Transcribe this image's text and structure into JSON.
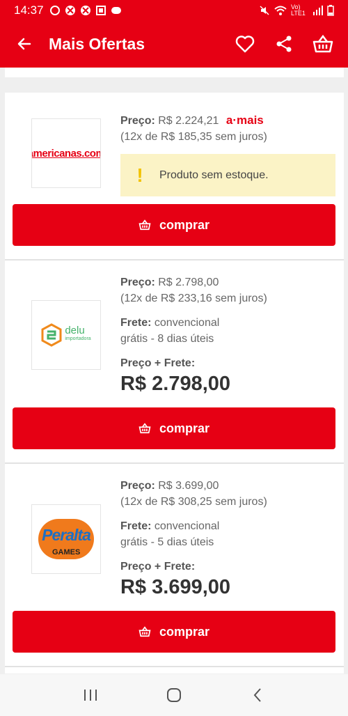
{
  "status_bar": {
    "time": "14:37",
    "network": "Vo) LTE1"
  },
  "app_bar": {
    "title": "Mais Ofertas"
  },
  "offers": [
    {
      "seller": "americanas.com",
      "price_label": "Preço:",
      "price": "R$ 2.224,21",
      "badge": "a·mais",
      "installments": "(12x de R$ 185,35 sem juros)",
      "notice": "Produto sem estoque.",
      "buy_label": "comprar"
    },
    {
      "seller": "delu importadora",
      "seller_name": "delu",
      "seller_sub": "importadora",
      "price_label": "Preço:",
      "price": "R$ 2.798,00",
      "installments": "(12x de R$ 233,16 sem juros)",
      "shipping_label": "Frete:",
      "shipping_type": "convencional",
      "shipping_time": "grátis - 8 dias úteis",
      "total_label": "Preço + Frete:",
      "total": "R$ 2.798,00",
      "buy_label": "comprar"
    },
    {
      "seller": "Peralta Games",
      "seller_name": "Peralta",
      "seller_sub": "GAMES",
      "price_label": "Preço:",
      "price": "R$ 3.699,00",
      "installments": "(12x de R$ 308,25 sem juros)",
      "shipping_label": "Frete:",
      "shipping_type": "convencional",
      "shipping_time": "grátis - 5 dias úteis",
      "total_label": "Preço + Frete:",
      "total": "R$ 3.699,00",
      "buy_label": "comprar"
    }
  ],
  "colors": {
    "brand_red": "#e60014",
    "warning_bg": "#fbf3c6",
    "warning_mark": "#f2c200"
  },
  "icons": [
    "back-arrow-icon",
    "heart-icon",
    "share-icon",
    "basket-icon",
    "recents-icon",
    "home-icon",
    "back-icon"
  ]
}
